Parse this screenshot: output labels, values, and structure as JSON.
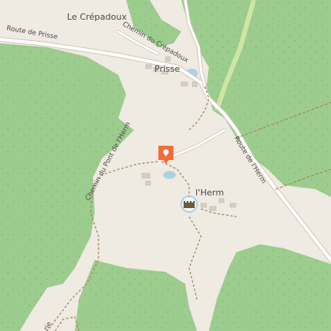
{
  "map": {
    "places": [
      {
        "key": "crepadoux",
        "name": "Le Crépadoux"
      },
      {
        "key": "prisse",
        "name": "Prisse"
      },
      {
        "key": "lherm",
        "name": "l'Herm"
      }
    ],
    "roads": [
      {
        "key": "route-de-prisse",
        "name": "Route de Prisse"
      },
      {
        "key": "chemin-du-crepadoux",
        "name": "Chemin du Crépadoux"
      },
      {
        "key": "chemin-du-pont-de-lherm",
        "name": "Chemin du Pont de l'Herm"
      },
      {
        "key": "route-de-lherm",
        "name": "Route de l'Herm"
      },
      {
        "key": "bottom-road-fragment",
        "name": "rie"
      }
    ],
    "markers": [
      {
        "key": "location-pin",
        "icon": "map-pin-icon",
        "color": "#f26b3a"
      },
      {
        "key": "castle-poi",
        "icon": "castle-icon",
        "color": "#6f5a3a"
      }
    ],
    "colors": {
      "land": "#efeae2",
      "forest": "#9ccc8e",
      "forest_tree_dots": "#86b878",
      "water": "#aad3df",
      "road": "#ffffff",
      "road_casing": "#cfc8bc",
      "trail": "#a88b5e",
      "pin": "#f26b3a",
      "green_track": "#cfe5a8"
    }
  }
}
